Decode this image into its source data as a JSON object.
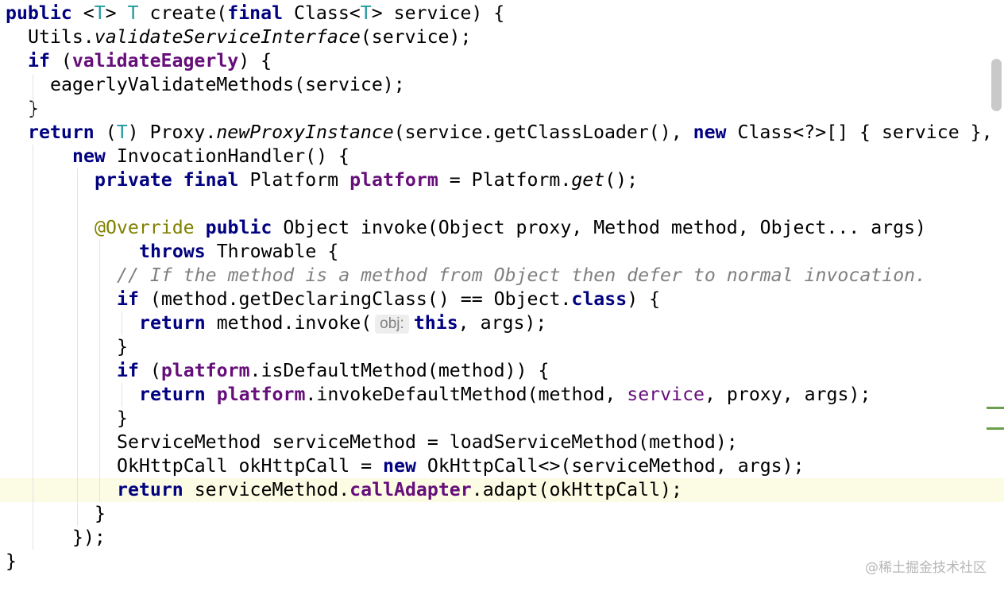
{
  "editor": {
    "lines": [
      {
        "segments": [
          {
            "t": "public",
            "c": "kw"
          },
          {
            "t": " <"
          },
          {
            "t": "T",
            "c": "tp"
          },
          {
            "t": "> "
          },
          {
            "t": "T",
            "c": "tp"
          },
          {
            "t": " create("
          },
          {
            "t": "final",
            "c": "kw"
          },
          {
            "t": " Class<"
          },
          {
            "t": "T",
            "c": "tp"
          },
          {
            "t": "> service) {"
          }
        ]
      },
      {
        "segments": [
          {
            "t": "Utils."
          },
          {
            "t": "validateServiceInterface",
            "c": "it"
          },
          {
            "t": "(service);"
          }
        ]
      },
      {
        "segments": [
          {
            "t": "if",
            "c": "kw"
          },
          {
            "t": " ("
          },
          {
            "t": "validateEagerly",
            "c": "fld"
          },
          {
            "t": ") {"
          }
        ]
      },
      {
        "segments": [
          {
            "t": "eagerlyValidateMethods(service);"
          }
        ]
      },
      {
        "segments": [
          {
            "t": "}"
          }
        ]
      },
      {
        "segments": [
          {
            "t": "return",
            "c": "kw"
          },
          {
            "t": " ("
          },
          {
            "t": "T",
            "c": "tp"
          },
          {
            "t": ") Proxy."
          },
          {
            "t": "newProxyInstance",
            "c": "it"
          },
          {
            "t": "(service.getClassLoader(), "
          },
          {
            "t": "new",
            "c": "kw"
          },
          {
            "t": " Class<?>[] { service },"
          }
        ]
      },
      {
        "segments": [
          {
            "t": "new",
            "c": "kw"
          },
          {
            "t": " InvocationHandler() {"
          }
        ]
      },
      {
        "segments": [
          {
            "t": "private final",
            "c": "kw"
          },
          {
            "t": " Platform "
          },
          {
            "t": "platform",
            "c": "fld"
          },
          {
            "t": " = Platform."
          },
          {
            "t": "get",
            "c": "it"
          },
          {
            "t": "();"
          }
        ]
      },
      {
        "segments": []
      },
      {
        "segments": [
          {
            "t": "@Override",
            "c": "ann"
          },
          {
            "t": " "
          },
          {
            "t": "public",
            "c": "kw"
          },
          {
            "t": " Object invoke(Object proxy, Method method, Object... args)"
          }
        ]
      },
      {
        "segments": [
          {
            "t": "throws",
            "c": "kw"
          },
          {
            "t": " Throwable {"
          }
        ]
      },
      {
        "segments": [
          {
            "t": "// If the method is a method from Object then defer to normal invocation.",
            "c": "cm"
          }
        ]
      },
      {
        "segments": [
          {
            "t": "if",
            "c": "kw"
          },
          {
            "t": " (method.getDeclaringClass() == Object."
          },
          {
            "t": "class",
            "c": "kw"
          },
          {
            "t": ") {"
          }
        ]
      },
      {
        "segments": [
          {
            "t": "return",
            "c": "kw"
          },
          {
            "t": " method.invoke("
          },
          {
            "t": "obj:",
            "c": "hint"
          },
          {
            "t": "this",
            "c": "kw"
          },
          {
            "t": ", args);"
          }
        ]
      },
      {
        "segments": [
          {
            "t": "}"
          }
        ]
      },
      {
        "segments": [
          {
            "t": "if",
            "c": "kw"
          },
          {
            "t": " ("
          },
          {
            "t": "platform",
            "c": "fld"
          },
          {
            "t": ".isDefaultMethod(method)) {"
          }
        ]
      },
      {
        "segments": [
          {
            "t": "return",
            "c": "kw"
          },
          {
            "t": " "
          },
          {
            "t": "platform",
            "c": "fld"
          },
          {
            "t": ".invokeDefaultMethod(method, "
          },
          {
            "t": "service",
            "c": "fldp"
          },
          {
            "t": ", proxy, args);"
          }
        ]
      },
      {
        "segments": [
          {
            "t": "}"
          }
        ]
      },
      {
        "segments": [
          {
            "t": "ServiceMethod serviceMethod = loadServiceMethod(method);"
          }
        ]
      },
      {
        "segments": [
          {
            "t": "OkHttpCall okHttpCall = "
          },
          {
            "t": "new",
            "c": "kw"
          },
          {
            "t": " OkHttpCall<>(serviceMethod, args);"
          }
        ]
      },
      {
        "segments": [
          {
            "t": "return",
            "c": "kw"
          },
          {
            "t": " serviceMethod."
          },
          {
            "t": "callAdapter",
            "c": "fld"
          },
          {
            "t": ".adapt(okHttpCall);"
          }
        ]
      },
      {
        "segments": [
          {
            "t": "}"
          }
        ]
      },
      {
        "segments": [
          {
            "t": "});"
          }
        ]
      },
      {
        "segments": [
          {
            "t": "}"
          }
        ]
      }
    ]
  },
  "watermark": {
    "text": "@稀土掘金技术社区"
  },
  "colors": {
    "keyword": "#000080",
    "field": "#660e7a",
    "type_param": "#20999d",
    "annotation": "#808000",
    "comment": "#808080",
    "current_line": "#fcfbe3",
    "change_marker": "#6a9f4b"
  }
}
